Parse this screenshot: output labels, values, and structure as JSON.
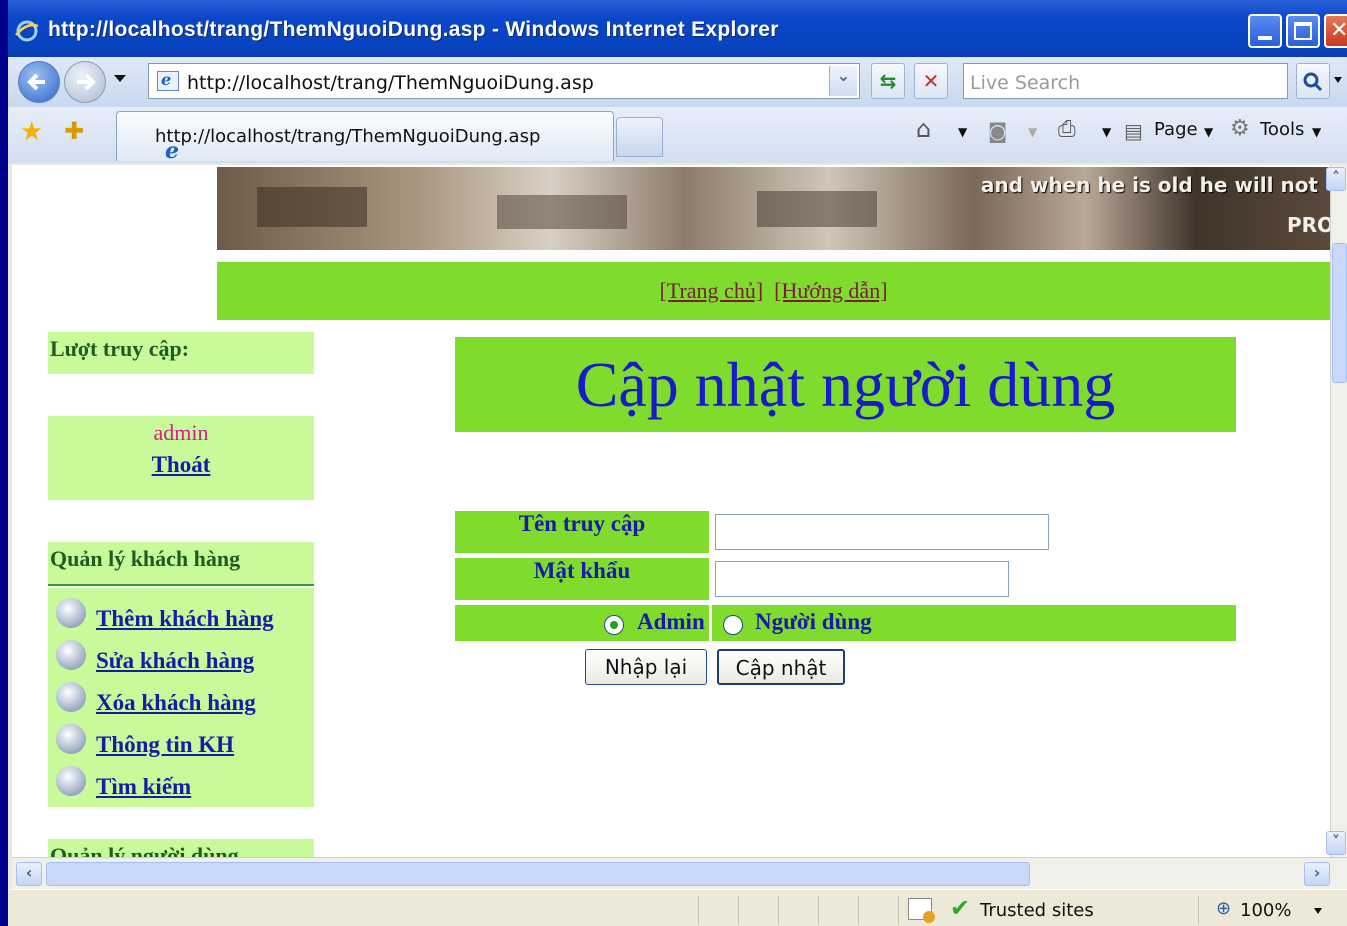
{
  "window": {
    "title": "http://localhost/trang/ThemNguoiDung.asp - Windows Internet Explorer"
  },
  "navbar": {
    "address": "http://localhost/trang/ThemNguoiDung.asp",
    "search_placeholder": "Live Search"
  },
  "tabs": [
    {
      "label": "http://localhost/trang/ThemNguoiDung.asp"
    }
  ],
  "toolbar": {
    "page_label": "Page",
    "tools_label": "Tools"
  },
  "banner": {
    "caption": "and when he is old he will not",
    "caption2": "PRO"
  },
  "menu": {
    "home": "[Trang chủ]",
    "help": "[Hướng dẫn]"
  },
  "sidebar": {
    "visits_label": "Lượt truy cập:",
    "user": "admin",
    "logout": "Thoát",
    "customers_heading": "Quản lý khách hàng",
    "customer_links": [
      {
        "label": "Thêm khách hàng"
      },
      {
        "label": "Sửa khách hàng"
      },
      {
        "label": "Xóa khách hàng"
      },
      {
        "label": "Thông tin KH"
      },
      {
        "label": "Tìm kiếm"
      }
    ],
    "users_heading": "Quản lý người dùng"
  },
  "form": {
    "title": "Cập nhật người dùng",
    "username_label": "Tên truy cập",
    "username_value": "",
    "password_label": "Mật khẩu",
    "password_value": "",
    "role_options": [
      "Admin",
      "Người dùng"
    ],
    "role_selected": "Admin",
    "reset_label": "Nhập lại",
    "submit_label": "Cập nhật"
  },
  "status": {
    "zone": "Trusted sites",
    "zoom": "100%"
  }
}
